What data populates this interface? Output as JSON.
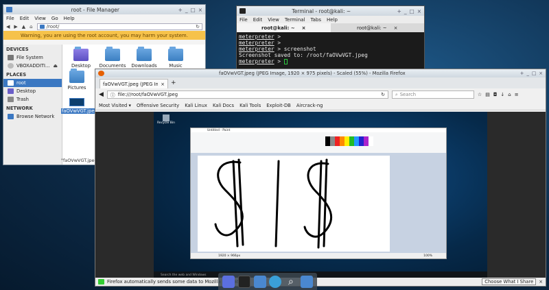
{
  "file_manager": {
    "title": "root - File Manager",
    "menu": [
      "File",
      "Edit",
      "View",
      "Go",
      "Help"
    ],
    "location": "/root/",
    "warning": "Warning, you are using the root account, you may harm your system.",
    "sections": {
      "devices": "DEVICES",
      "places": "PLACES",
      "network": "NETWORK"
    },
    "devices": [
      "File System",
      "VBOXADDITI..."
    ],
    "places": [
      "root",
      "Desktop",
      "Trash"
    ],
    "network": [
      "Browse Network"
    ],
    "files": [
      "Desktop",
      "Documents",
      "Downloads",
      "Music",
      "Pictures",
      "faOVwVGT.jpeg"
    ],
    "status": "\"faOVwVGT.jpeg\" (8"
  },
  "terminal": {
    "title": "Terminal - root@kali: ~",
    "menu": [
      "File",
      "Edit",
      "View",
      "Terminal",
      "Tabs",
      "Help"
    ],
    "tabs": [
      "root@kali: ~",
      "root@kali: ~"
    ],
    "lines": [
      {
        "prompt": "meterpreter",
        "rest": " >"
      },
      {
        "prompt": "meterpreter",
        "rest": " >"
      },
      {
        "prompt": "meterpreter",
        "rest": " > screenshot"
      },
      {
        "prompt": "",
        "rest": "Screenshot saved to: /root/faOVwVGT.jpeg"
      },
      {
        "prompt": "meterpreter",
        "rest": " > "
      }
    ]
  },
  "firefox": {
    "title": "faOVwVGT.jpeg (JPEG Image, 1920 × 975 pixels) - Scaled (55%) - Mozilla Firefox",
    "tab": "faOVwVGT.jpeg (JPEG Im...",
    "url": "file:///root/faOVwVGT.jpeg",
    "search_placeholder": "Search",
    "bookmarks": [
      "Most Visited ▾",
      "Offensive Security",
      "Kali Linux",
      "Kali Docs",
      "Kali Tools",
      "Exploit-DB",
      "Aircrack-ng"
    ],
    "notification": "Firefox automatically sends some data to Mozilla so that w",
    "share_button": "Choose What I Share",
    "inner": {
      "paint_title": "Untitled - Paint",
      "recycle": "Recycle Bin",
      "search_windows": "Search the web and Windows",
      "zoom": "100%",
      "dims": "1920 × 966px"
    }
  },
  "colors": {
    "accent": "#3b78c2",
    "warning": "#f6c24a"
  }
}
